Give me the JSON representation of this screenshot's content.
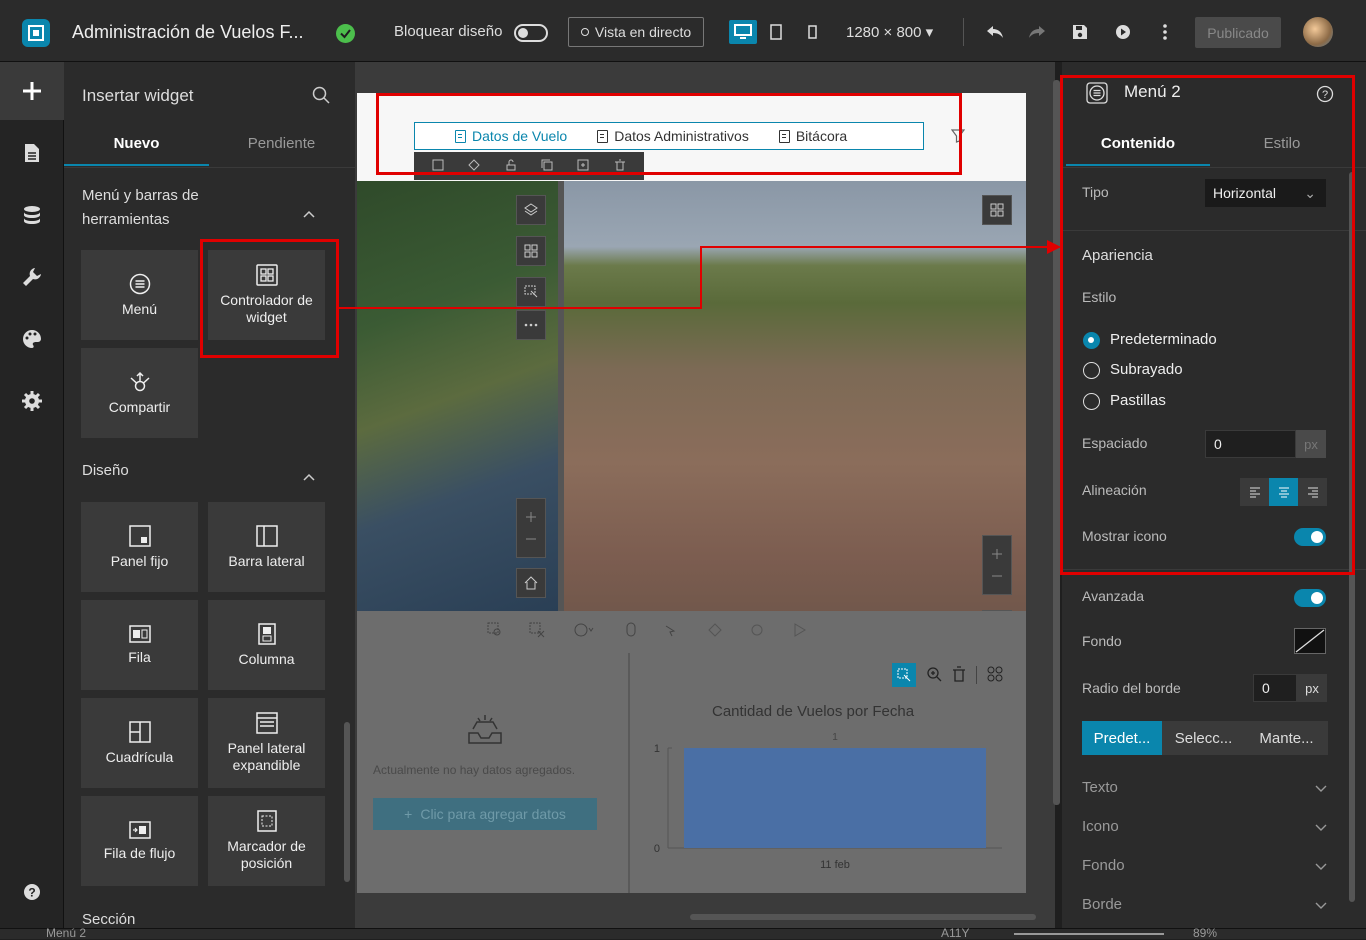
{
  "topbar": {
    "app_title": "Administración de Vuelos F...",
    "lock_label": "Bloquear diseño",
    "live_view": "Vista en directo",
    "screen_size": "1280 × 800",
    "publish": "Publicado"
  },
  "widget_panel": {
    "title": "Insertar widget",
    "tabs": [
      "Nuevo",
      "Pendiente"
    ],
    "sections": [
      {
        "title": "Menú y barras de herramientas",
        "widgets": [
          "Menú",
          "Controlador de widget",
          "Compartir"
        ]
      },
      {
        "title": "Diseño",
        "widgets": [
          "Panel fijo",
          "Barra lateral",
          "Fila",
          "Columna",
          "Cuadrícula",
          "Panel lateral expandible",
          "Fila de flujo",
          "Marcador de posición"
        ]
      },
      {
        "title": "Sección"
      }
    ]
  },
  "canvas": {
    "menu_items": [
      "Datos de Vuelo",
      "Datos Administrativos",
      "Bitácora"
    ],
    "no_data_text": "Actualmente no hay datos agregados.",
    "add_data_btn": "Clic para agregar datos",
    "chart_title": "Cantidad de Vuelos por Fecha"
  },
  "chart_data": {
    "type": "bar",
    "title": "Cantidad de Vuelos por Fecha",
    "categories": [
      "11 feb"
    ],
    "values": [
      1
    ],
    "ylim": [
      0,
      1
    ],
    "ytick_labels": [
      "0",
      "1"
    ],
    "data_labels": [
      "1"
    ],
    "colors": [
      "#4a6fa5"
    ]
  },
  "props": {
    "title": "Menú 2",
    "tabs": [
      "Contenido",
      "Estilo"
    ],
    "type_label": "Tipo",
    "type_value": "Horizontal",
    "appearance": "Apariencia",
    "style_label": "Estilo",
    "style_options": [
      "Predeterminado",
      "Subrayado",
      "Pastillas"
    ],
    "spacing_label": "Espaciado",
    "spacing_value": "0",
    "px": "px",
    "align_label": "Alineación",
    "show_icon": "Mostrar icono",
    "advanced": "Avanzada",
    "background": "Fondo",
    "radius_label": "Radio del borde",
    "radius_value": "0",
    "state_tabs": [
      "Predet...",
      "Selecc...",
      "Mante..."
    ],
    "collapsibles": [
      "Texto",
      "Icono",
      "Fondo",
      "Borde"
    ]
  },
  "statusbar": {
    "left": "Menú 2",
    "breakpoint": "A11Y",
    "zoom": "89%"
  },
  "colors": {
    "accent": "#0a86ad",
    "highlight": "#e00000",
    "bar": "#4a6fa5"
  }
}
